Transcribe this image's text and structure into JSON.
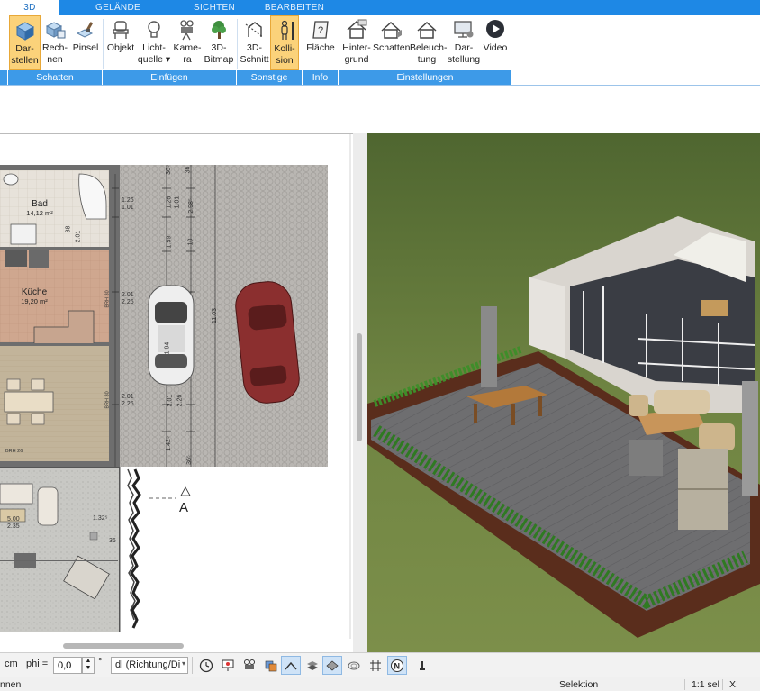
{
  "tabs": [
    {
      "label": "3D",
      "active": true
    },
    {
      "label": "GELÄNDE",
      "active": false
    },
    {
      "label": "SICHTEN",
      "active": false
    },
    {
      "label": "BEARBEITEN",
      "active": false
    }
  ],
  "ribbon": {
    "buttons": {
      "darstellen": {
        "line1": "Dar-",
        "line2": "stellen",
        "icon": "cube-render-icon",
        "active": true
      },
      "rechnen": {
        "line1": "Rech-",
        "line2": "nen",
        "icon": "cube-calc-icon"
      },
      "pinsel": {
        "line1": "Pinsel",
        "line2": "",
        "icon": "brush-icon"
      },
      "objekt": {
        "line1": "Objekt",
        "line2": "",
        "icon": "chair-icon"
      },
      "lichtquelle": {
        "line1": "Licht-",
        "line2": "quelle ▾",
        "icon": "lightbulb-icon"
      },
      "kamera": {
        "line1": "Kame-",
        "line2": "ra",
        "icon": "camera-icon"
      },
      "bitmap3d": {
        "line1": "3D-",
        "line2": "Bitmap",
        "icon": "tree-icon"
      },
      "schnitt3d": {
        "line1": "3D-",
        "line2": "Schnitt",
        "icon": "section-icon"
      },
      "kollision": {
        "line1": "Kolli-",
        "line2": "sion",
        "icon": "person-icon",
        "active": true
      },
      "flaeche": {
        "line1": "Fläche",
        "line2": "",
        "icon": "area-question-icon"
      },
      "hintergrund": {
        "line1": "Hinter-",
        "line2": "grund",
        "icon": "house-bg-icon"
      },
      "schatten": {
        "line1": "Schatten",
        "line2": "",
        "icon": "house-shadow-icon"
      },
      "beleuchtung": {
        "line1": "Beleuch-",
        "line2": "tung",
        "icon": "house-light-icon"
      },
      "darstellung": {
        "line1": "Dar-",
        "line2": "stellung",
        "icon": "monitor-settings-icon"
      },
      "video": {
        "line1": "Video",
        "line2": "",
        "icon": "play-icon"
      }
    },
    "groups": {
      "schatten": "Schatten",
      "einfuegen": "Einfügen",
      "sonstige": "Sonstige",
      "info": "Info",
      "einstellungen": "Einstellungen"
    }
  },
  "plan": {
    "rooms": {
      "bad": {
        "name": "Bad",
        "area": "14,12 m²"
      },
      "kueche": {
        "name": "Küche",
        "area": "19,20 m²"
      }
    },
    "dims": {
      "d1": "1.26",
      "d2": "1.01",
      "d3": "1.26",
      "d4": "1.01",
      "d5": "2.98⁵",
      "d6": "1.59",
      "d7": "10",
      "d8": "11.03",
      "d9": "2.01",
      "d10": "2.26",
      "d11": "1.94",
      "d12": "2.01",
      "d13": "2.26",
      "d14": "2.01",
      "d15": "2.26",
      "d16": "1.42⁵",
      "d17": "36⁵",
      "d18": "1.32⁵",
      "d19": "36",
      "d20": "5.00",
      "d21": "2.35",
      "d22": "BRH 30",
      "d23": "BRH 30",
      "d24": "BRH 26",
      "d25": "36",
      "d26": "36⁵",
      "d27": "88",
      "d28": "2.01"
    },
    "section_marker": "A"
  },
  "toolbar": {
    "unit": "cm",
    "phi_label": "phi =",
    "phi_value": "0,0",
    "degree": "°",
    "direction_value": "dl (Richtung/Di"
  },
  "statusbar": {
    "left": "nnen",
    "mode": "Selektion",
    "scale": "1:1 sel",
    "x_label": "X:"
  },
  "colors": {
    "tab_bar": "#1e88e5",
    "group_bar": "#3d9ae8",
    "active_button": "#fbd27a",
    "grass": "#6b7d3e"
  }
}
